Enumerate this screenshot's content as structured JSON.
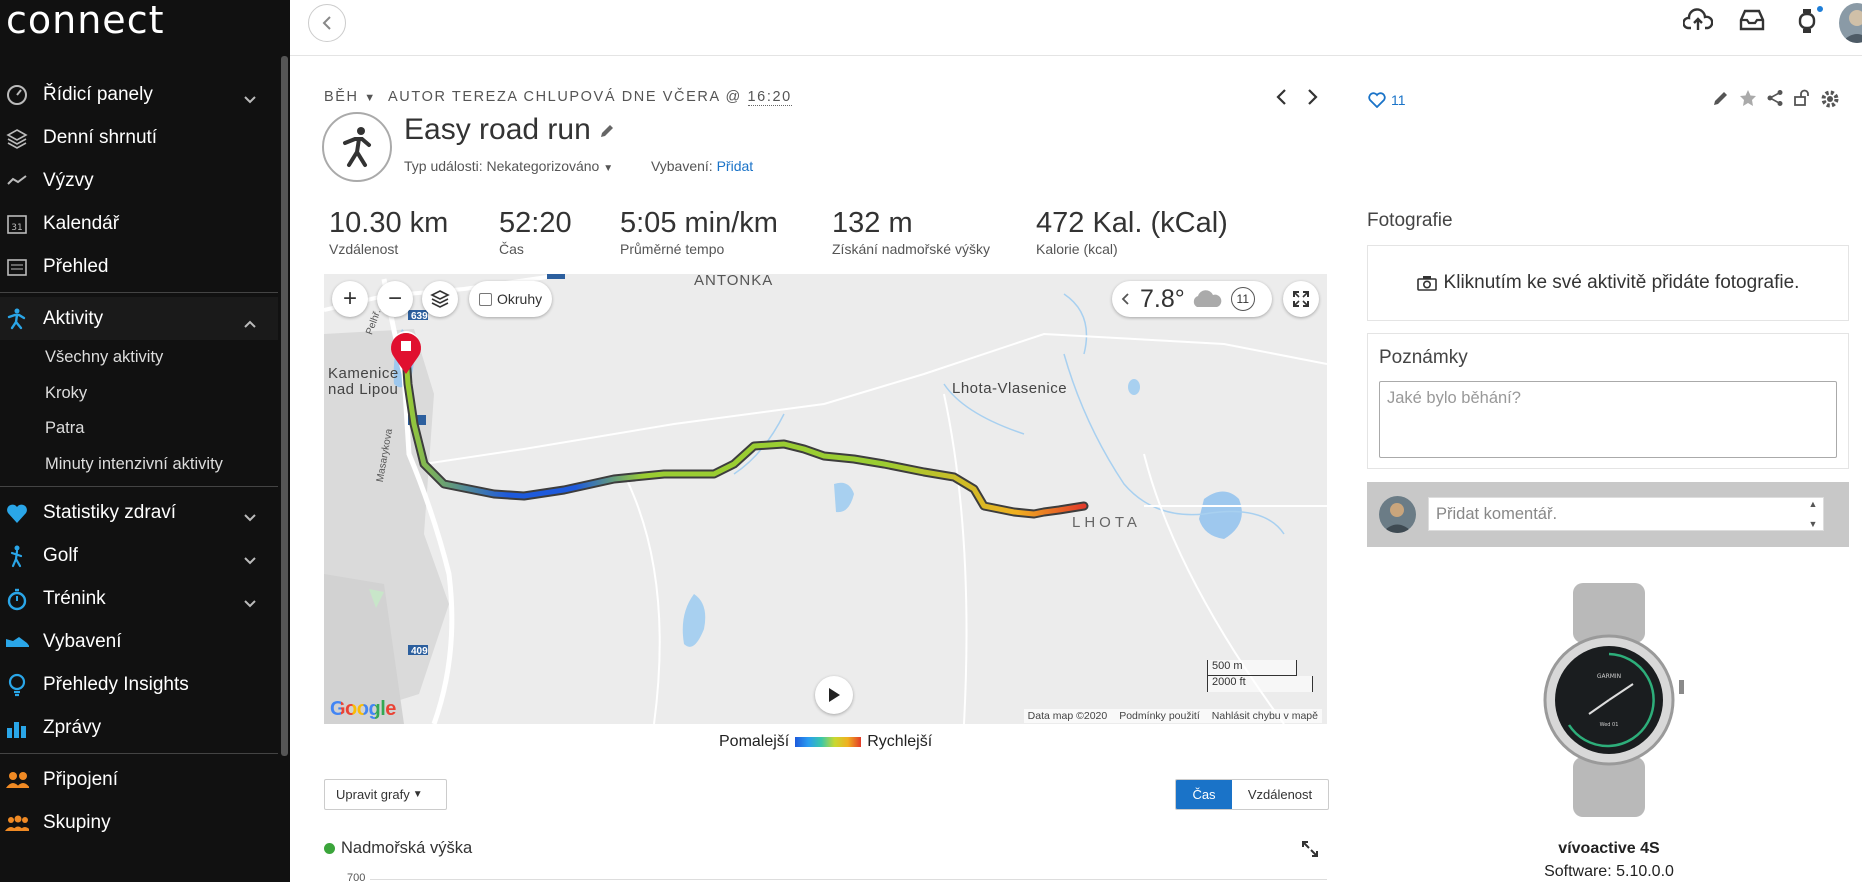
{
  "app": {
    "logo": "connect"
  },
  "sidebar": {
    "items": [
      {
        "label": "Řídicí panely",
        "icon": "dashboard-icon",
        "chevron": "down"
      },
      {
        "label": "Denní shrnutí",
        "icon": "layers-icon"
      },
      {
        "label": "Výzvy",
        "icon": "challenge-icon"
      },
      {
        "label": "Kalendář",
        "icon": "calendar-icon"
      },
      {
        "label": "Přehled",
        "icon": "news-icon"
      },
      {
        "label": "Aktivity",
        "icon": "runner-icon",
        "chevron": "up"
      },
      {
        "label": "Statistiky zdraví",
        "icon": "heart-icon",
        "chevron": "down"
      },
      {
        "label": "Golf",
        "icon": "golf-icon",
        "chevron": "down"
      },
      {
        "label": "Trénink",
        "icon": "stopwatch-icon",
        "chevron": "down"
      },
      {
        "label": "Vybavení",
        "icon": "shoe-icon"
      },
      {
        "label": "Přehledy Insights",
        "icon": "lightbulb-icon"
      },
      {
        "label": "Zprávy",
        "icon": "bar-chart-icon"
      },
      {
        "label": "Připojení",
        "icon": "people-icon"
      },
      {
        "label": "Skupiny",
        "icon": "group-icon"
      }
    ],
    "activity_subitems": [
      "Všechny aktivity",
      "Kroky",
      "Patra",
      "Minuty intenzivní aktivity"
    ],
    "calendar_day": "31"
  },
  "activity": {
    "type": "BĚH",
    "author_text": "AUTOR TEREZA CHLUPOVÁ DNE VČERA @",
    "time": "16:20",
    "title": "Easy road run",
    "event_type_label": "Typ události:",
    "event_type_value": "Nekategorizováno",
    "gear_label": "Vybavení:",
    "gear_value": "Přidat",
    "likes": "11"
  },
  "stats": [
    {
      "value": "10.30 km",
      "label": "Vzdálenost"
    },
    {
      "value": "52:20",
      "label": "Čas"
    },
    {
      "value": "5:05 min/km",
      "label": "Průměrné tempo"
    },
    {
      "value": "132 m",
      "label": "Získání nadmořské výšky"
    },
    {
      "value": "472 Kal. (kCal)",
      "label": "Kalorie (kcal)"
    }
  ],
  "map": {
    "zoom_in": "+",
    "zoom_out": "−",
    "laps_label": "Okruhy",
    "temperature": "7.8°",
    "weather_count": "11",
    "places": [
      "ANTONKA",
      "Kamenice",
      "nad Lipou",
      "Lhota-Vlasenice",
      "LHOTA",
      "Masarykova",
      "Pelhř..."
    ],
    "road_numbers": [
      "639",
      "409"
    ],
    "scale_metric": "500 m",
    "scale_imperial": "2000 ft",
    "footer": [
      "Data map ©2020",
      "Podmínky použití",
      "Nahlásit chybu v mapě"
    ],
    "provider": "Google",
    "route_colors": {
      "slow": "#1e5adc",
      "mid": "#9acd32",
      "fast": "#e23b2a"
    }
  },
  "legend": {
    "slower": "Pomalejší",
    "faster": "Rychlejší"
  },
  "charts": {
    "edit_button": "Upravit grafy",
    "seg_time": "Čas",
    "seg_distance": "Vzdálenost",
    "elevation_title": "Nadmořská výška",
    "elevation_y_tick": "700"
  },
  "right": {
    "photos_title": "Fotografie",
    "photos_cta": "Kliknutím ke své aktivitě přidáte fotografie.",
    "notes_title": "Poznámky",
    "notes_placeholder": "Jaké bylo běhání?",
    "comment_placeholder": "Přidat komentář.",
    "device_name": "vívoactive 4S",
    "device_software": "Software: 5.10.0.0",
    "watch_brand": "GARMIN",
    "watch_date": "Wed 01"
  }
}
